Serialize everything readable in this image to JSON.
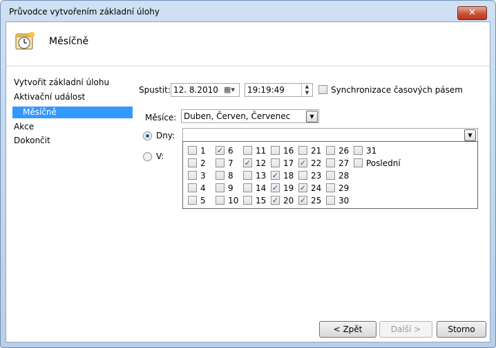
{
  "window": {
    "title": "Průvodce vytvořením základní úlohy",
    "close_glyph": "✕"
  },
  "header": {
    "title": "Měsíčně",
    "icon": "clock-calendar-icon"
  },
  "nav": {
    "items": [
      {
        "label": "Vytvořit základní úlohu"
      },
      {
        "label": "Aktivační událost"
      },
      {
        "label": "Měsíčně"
      },
      {
        "label": "Akce"
      },
      {
        "label": "Dokončit"
      }
    ]
  },
  "form": {
    "start_label": "Spustit:",
    "start_date": "12.  8.2010",
    "start_time": "19:19:49",
    "sync_label": "Synchronizace časových pásem",
    "months_label": "Měsíce:",
    "months_value": "Duben, Červen, Červenec",
    "days_label": "Dny:",
    "days_value": "",
    "on_label": "V:"
  },
  "days": [
    {
      "label": "1",
      "checked": false
    },
    {
      "label": "6",
      "checked": true
    },
    {
      "label": "11",
      "checked": false
    },
    {
      "label": "16",
      "checked": false
    },
    {
      "label": "21",
      "checked": false
    },
    {
      "label": "26",
      "checked": false
    },
    {
      "label": "31",
      "checked": false
    },
    {
      "label": "2",
      "checked": false
    },
    {
      "label": "7",
      "checked": false
    },
    {
      "label": "12",
      "checked": true
    },
    {
      "label": "17",
      "checked": false
    },
    {
      "label": "22",
      "checked": true
    },
    {
      "label": "27",
      "checked": false
    },
    {
      "label": "Poslední",
      "checked": false
    },
    {
      "label": "3",
      "checked": false
    },
    {
      "label": "8",
      "checked": false
    },
    {
      "label": "13",
      "checked": false
    },
    {
      "label": "18",
      "checked": true
    },
    {
      "label": "23",
      "checked": false
    },
    {
      "label": "28",
      "checked": false
    },
    {
      "label": "4",
      "checked": false
    },
    {
      "label": "9",
      "checked": false
    },
    {
      "label": "14",
      "checked": false
    },
    {
      "label": "19",
      "checked": true
    },
    {
      "label": "24",
      "checked": true
    },
    {
      "label": "29",
      "checked": false
    },
    {
      "label": "5",
      "checked": false
    },
    {
      "label": "10",
      "checked": false
    },
    {
      "label": "15",
      "checked": false
    },
    {
      "label": "20",
      "checked": true
    },
    {
      "label": "25",
      "checked": true
    },
    {
      "label": "30",
      "checked": false
    }
  ],
  "buttons": {
    "back": "< Zpět",
    "next": "Další >",
    "cancel": "Storno"
  }
}
